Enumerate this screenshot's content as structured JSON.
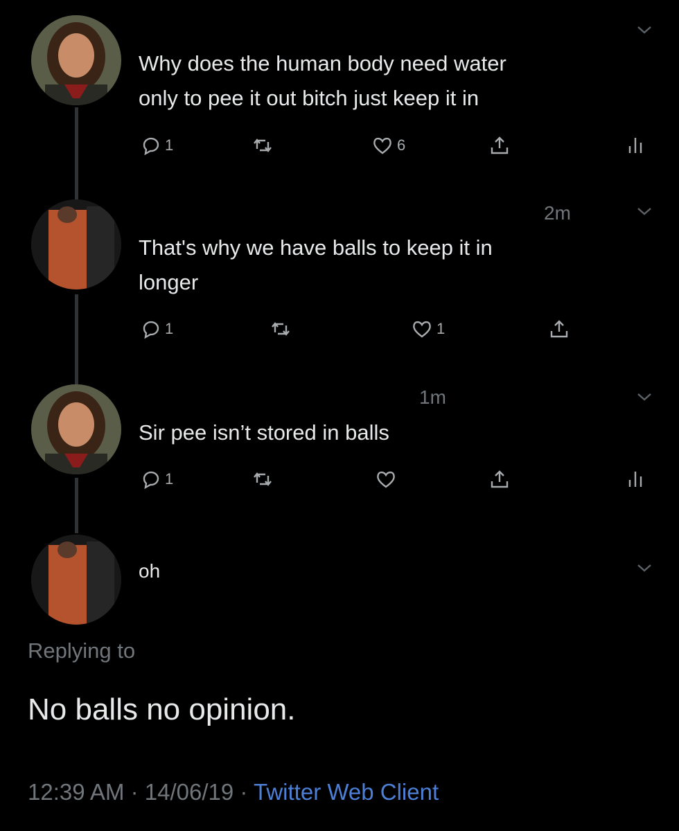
{
  "tweets": [
    {
      "meta_left": "",
      "meta_right": "",
      "text_lines": [
        "Why does the human body need water",
        "only to pee it out bitch just keep it in"
      ],
      "reply_count": "1",
      "retweet_count": "",
      "like_count": "6"
    },
    {
      "meta_left": "",
      "meta_right": "2m",
      "text_lines": [
        "That's why we have balls to keep it in",
        "longer"
      ],
      "reply_count": "1",
      "retweet_count": "",
      "like_count": "1"
    },
    {
      "meta_left": "",
      "meta_right": "1m",
      "text_lines": [
        "Sir pee isn’t stored in balls"
      ],
      "reply_count": "1",
      "retweet_count": "",
      "like_count": ""
    },
    {
      "meta_left": "oh",
      "meta_right": "",
      "text_lines": []
    }
  ],
  "main_tweet": {
    "replying_to": "Replying to",
    "text": "No balls no opinion.",
    "time": "12:39 AM",
    "date": "14/06/19",
    "client": "Twitter Web Client",
    "separator": "·"
  },
  "colors": {
    "background": "#000000",
    "text": "#e7e9ea",
    "muted": "#71767b",
    "link": "#4c7fd6"
  },
  "icons": [
    "reply-icon",
    "retweet-icon",
    "like-icon",
    "share-icon",
    "analytics-icon",
    "chevron-down-icon"
  ]
}
